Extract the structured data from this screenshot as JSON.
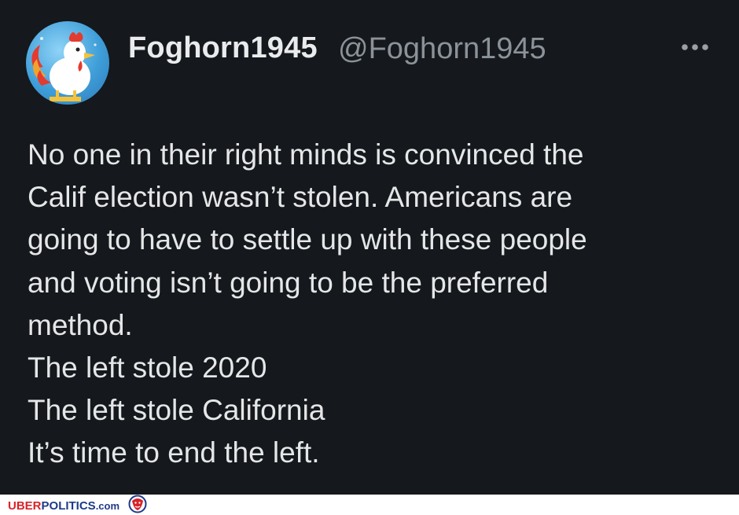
{
  "tweet": {
    "display_name": "Foghorn1945",
    "handle": "@Foghorn1945",
    "lines": [
      "No one in their right minds is convinced the",
      "Calif election wasn’t stolen. Americans are",
      "going to have to settle up with these people",
      "and voting isn’t going to be the preferred",
      "method.",
      "The left stole 2020",
      "The left stole California",
      "It’s time to end the left."
    ]
  },
  "watermark": {
    "uber": "UBER",
    "politics": "POLITICS",
    "com": ".com"
  },
  "colors": {
    "background": "#15181c",
    "text": "#e7e9ea",
    "muted": "#8b9299",
    "watermark_red": "#d8232a",
    "watermark_blue": "#1f3a8a"
  },
  "icons": {
    "avatar": "foghorn-rooster-avatar",
    "more": "more-horizontal-icon",
    "watermark_logo": "lion-crest-icon"
  }
}
